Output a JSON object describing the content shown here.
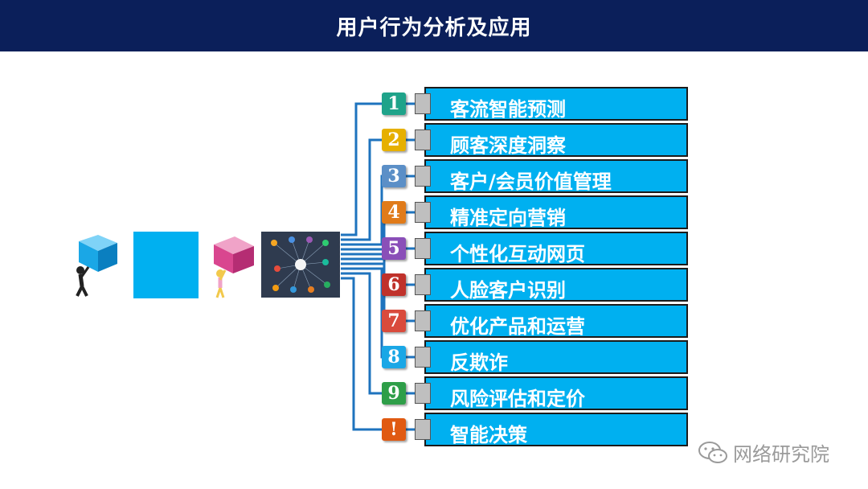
{
  "header": {
    "title": "用户行为分析及应用"
  },
  "items": [
    {
      "num": "1",
      "label": "客流智能预测",
      "color": "#1fa38a"
    },
    {
      "num": "2",
      "label": "顾客深度洞察",
      "color": "#e6b000"
    },
    {
      "num": "3",
      "label": "客户/会员价值管理",
      "color": "#5b8fc7"
    },
    {
      "num": "4",
      "label": "精准定向营销",
      "color": "#e07b1a"
    },
    {
      "num": "5",
      "label": "个性化互动网页",
      "color": "#8a4fb8"
    },
    {
      "num": "6",
      "label": "人脸客户识别",
      "color": "#c0322b"
    },
    {
      "num": "7",
      "label": "优化产品和运营",
      "color": "#d94b3c"
    },
    {
      "num": "8",
      "label": "反欺诈",
      "color": "#1aa7e6"
    },
    {
      "num": "9",
      "label": "风险评估和定价",
      "color": "#2e9e48"
    },
    {
      "num": "!",
      "label": "智能决策",
      "color": "#e05a12"
    }
  ],
  "footer": {
    "brand": "网络研究院"
  },
  "colors": {
    "header_bg": "#0b1f5a",
    "accent": "#00b0f0",
    "connector": "#1e73be"
  }
}
